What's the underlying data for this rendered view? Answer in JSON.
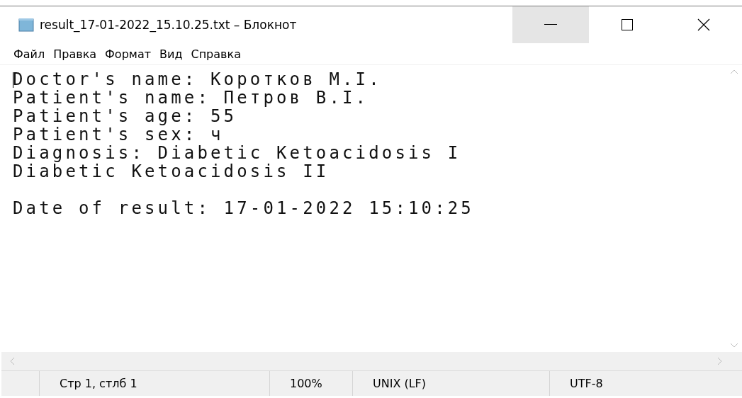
{
  "window": {
    "title": "result_17-01-2022_15.10.25.txt – Блокнот"
  },
  "menu": [
    "Файл",
    "Правка",
    "Формат",
    "Вид",
    "Справка"
  ],
  "document": {
    "paragraphs": [
      [
        "Doctor's name: Коротков М.I.",
        "Patient's name: Петров В.I.",
        "Patient's age: 55",
        "Patient's sex: ч",
        "Diagnosis: Diabetic Ketoacidosis I",
        "Diabetic Ketoacidosis II"
      ],
      [
        "Date of result: 17-01-2022 15:10:25"
      ]
    ]
  },
  "status_bar": [
    "Стр 1, стлб 1",
    "100%",
    "UNIX (LF)",
    "UTF-8"
  ]
}
